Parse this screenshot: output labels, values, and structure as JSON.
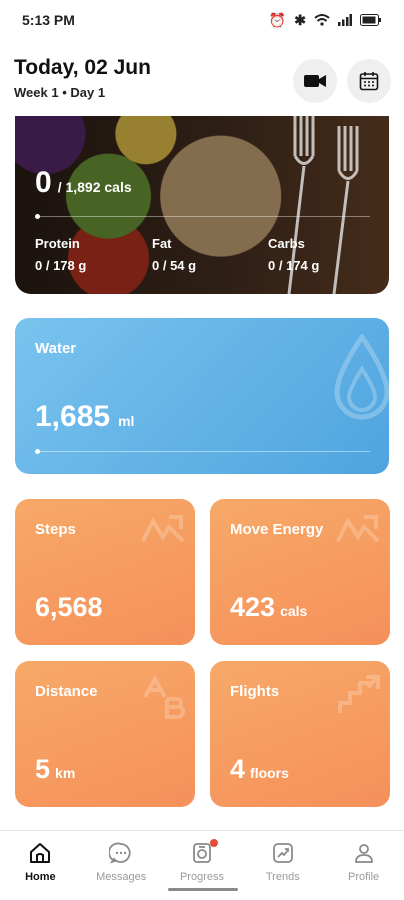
{
  "status_bar": {
    "time": "5:13 PM"
  },
  "header": {
    "title": "Today, 02 Jun",
    "week": "Week 1",
    "separator": "•",
    "day": "Day 1"
  },
  "food": {
    "calories": "0",
    "calories_total": "/ 1,892 cals",
    "macros": [
      {
        "label": "Protein",
        "value": "0 / 178 g"
      },
      {
        "label": "Fat",
        "value": "0 / 54 g"
      },
      {
        "label": "Carbs",
        "value": "0 / 174 g"
      }
    ],
    "progress": 0
  },
  "water": {
    "label": "Water",
    "value": "1,685",
    "unit": "ml",
    "progress": 0
  },
  "tiles": {
    "steps": {
      "label": "Steps",
      "value": "6,568",
      "unit": ""
    },
    "move_energy": {
      "label": "Move Energy",
      "value": "423",
      "unit": "cals"
    },
    "distance": {
      "label": "Distance",
      "value": "5",
      "unit": "km"
    },
    "flights": {
      "label": "Flights",
      "value": "4",
      "unit": "floors"
    }
  },
  "nav": [
    {
      "label": "Home",
      "icon": "home-icon"
    },
    {
      "label": "Messages",
      "icon": "messages-icon"
    },
    {
      "label": "Progress",
      "icon": "progress-icon"
    },
    {
      "label": "Trends",
      "icon": "trends-icon"
    },
    {
      "label": "Profile",
      "icon": "profile-icon"
    }
  ]
}
